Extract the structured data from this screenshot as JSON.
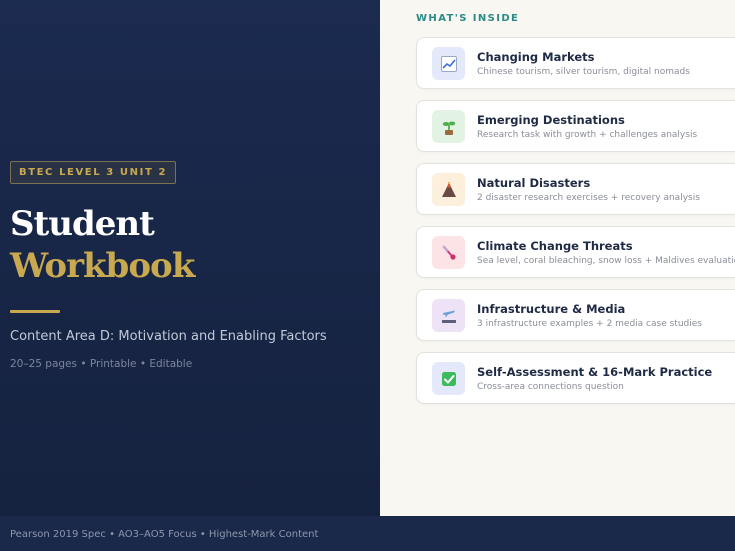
{
  "cover": {
    "badge": "BTEC LEVEL 3 UNIT 2",
    "title_line1": "Student",
    "title_line2": "Workbook",
    "subtitle": "Content Area D: Motivation and Enabling Factors",
    "meta": "20–25 pages • Printable • Editable"
  },
  "contents": {
    "heading": "WHAT'S INSIDE",
    "items": [
      {
        "title": "Changing Markets",
        "description": "Chinese tourism, silver tourism, digital nomads",
        "icon": "chart-icon",
        "icon_bg": "#e3e9fb"
      },
      {
        "title": "Emerging Destinations",
        "description": "Research task with growth + challenges analysis",
        "icon": "seedling-icon",
        "icon_bg": "#e3f3e3"
      },
      {
        "title": "Natural Disasters",
        "description": "2 disaster research exercises + recovery analysis",
        "icon": "volcano-icon",
        "icon_bg": "#fcefdc"
      },
      {
        "title": "Climate Change Threats",
        "description": "Sea level, coral bleaching, snow loss + Maldives evaluation",
        "icon": "thermometer-icon",
        "icon_bg": "#fbe3e6"
      },
      {
        "title": "Infrastructure & Media",
        "description": "3 infrastructure examples + 2 media case studies",
        "icon": "airport-icon",
        "icon_bg": "#ede2f6"
      },
      {
        "title": "Self-Assessment & 16-Mark Practice",
        "description": "Cross-area connections question",
        "icon": "checkbox-icon",
        "icon_bg": "#e3e9fb"
      }
    ]
  },
  "footer": {
    "text": "Pearson 2019 Spec • AO3–AO5 Focus • Highest-Mark Content"
  },
  "colors": {
    "navy": "#1b2a4f",
    "gold": "#c9a94f",
    "teal": "#2a8a86",
    "cream": "#f8f7f2"
  }
}
